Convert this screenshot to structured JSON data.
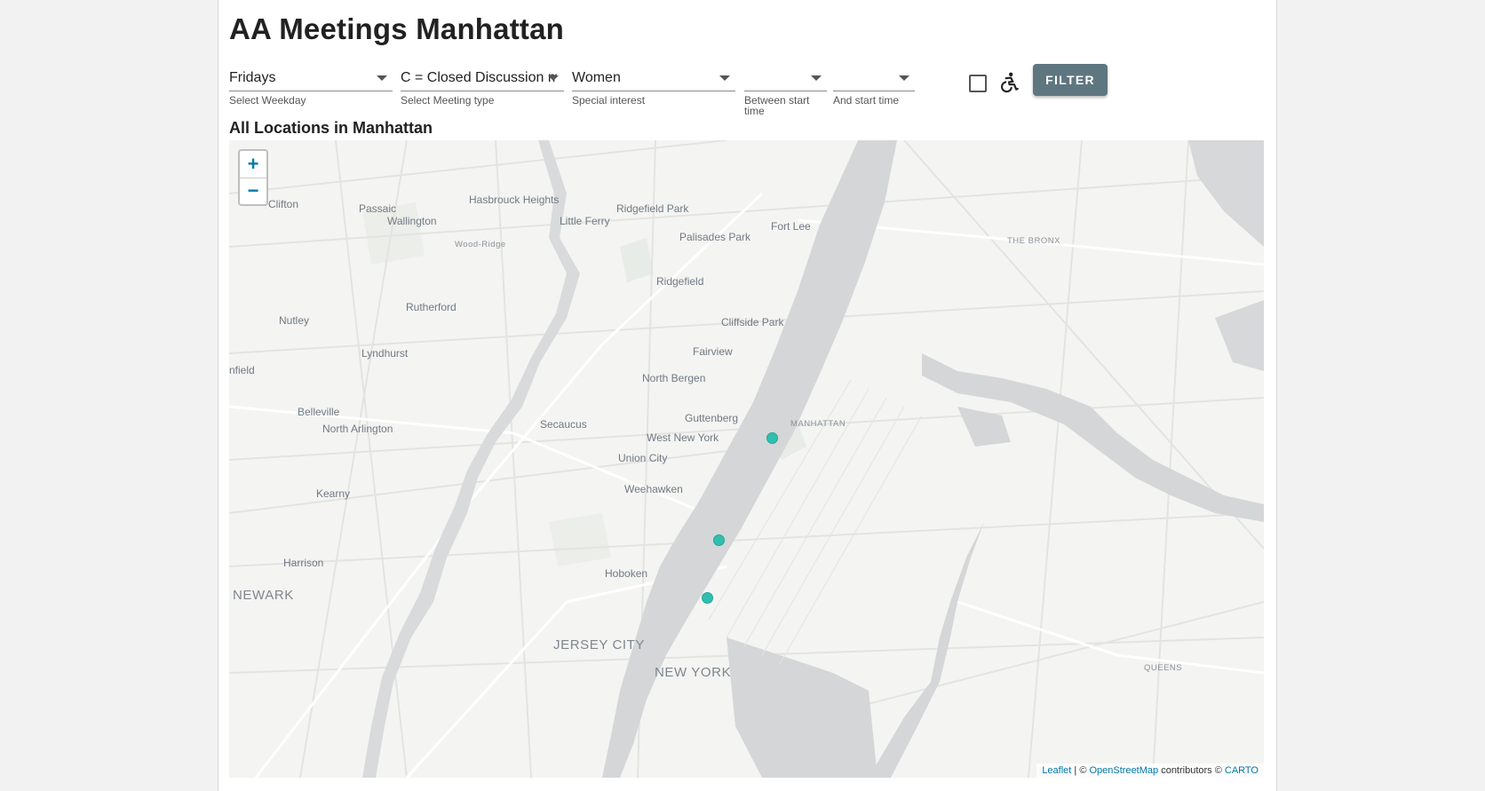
{
  "page": {
    "title": "AA Meetings Manhattan",
    "subtitle": "All Locations in Manhattan"
  },
  "filters": {
    "weekday": {
      "value": "Fridays",
      "label": "Select Weekday"
    },
    "meeting_type": {
      "value": "C = Closed Discussion meeting",
      "label": "Select Meeting type"
    },
    "special_interest": {
      "value": "Women",
      "label": "Special interest"
    },
    "start_time_from": {
      "value": "",
      "label": "Between start time"
    },
    "start_time_to": {
      "value": "",
      "label": "And start time"
    },
    "wheelchair_checkbox": {
      "checked": false,
      "icon": "wheelchair-icon"
    },
    "filter_button": "FILTER"
  },
  "map": {
    "zoom_in": "+",
    "zoom_out": "−",
    "places": [
      {
        "name": "Clifton"
      },
      {
        "name": "Passaic"
      },
      {
        "name": "Wallington"
      },
      {
        "name": "Hasbrouck Heights"
      },
      {
        "name": "Little Ferry"
      },
      {
        "name": "Ridgefield Park"
      },
      {
        "name": "Fort Lee"
      },
      {
        "name": "Palisades Park"
      },
      {
        "name": "Wood-Ridge"
      },
      {
        "name": "THE BRONX"
      },
      {
        "name": "Ridgefield"
      },
      {
        "name": "Rutherford"
      },
      {
        "name": "Nutley"
      },
      {
        "name": "Cliffside Park"
      },
      {
        "name": "Fairview"
      },
      {
        "name": "Lyndhurst"
      },
      {
        "name": "nfield"
      },
      {
        "name": "North Bergen"
      },
      {
        "name": "Belleville"
      },
      {
        "name": "Guttenberg"
      },
      {
        "name": "MANHATTAN"
      },
      {
        "name": "North Arlington"
      },
      {
        "name": "Secaucus"
      },
      {
        "name": "West New York"
      },
      {
        "name": "Union City"
      },
      {
        "name": "Kearny"
      },
      {
        "name": "Weehawken"
      },
      {
        "name": "Harrison"
      },
      {
        "name": "Hoboken"
      },
      {
        "name": "NEWARK"
      },
      {
        "name": "JERSEY CITY"
      },
      {
        "name": "NEW YORK"
      },
      {
        "name": "QUEENS"
      }
    ],
    "markers": 3,
    "marker_color": "#2fbfb0",
    "attribution": {
      "leaflet": "Leaflet",
      "sep": " | © ",
      "osm": "OpenStreetMap",
      "contrib": " contributors © ",
      "carto": "CARTO"
    }
  },
  "colors": {
    "button": "#5e7680",
    "water": "#d4d6d8",
    "land": "#f4f4f2",
    "link": "#0078a8"
  }
}
